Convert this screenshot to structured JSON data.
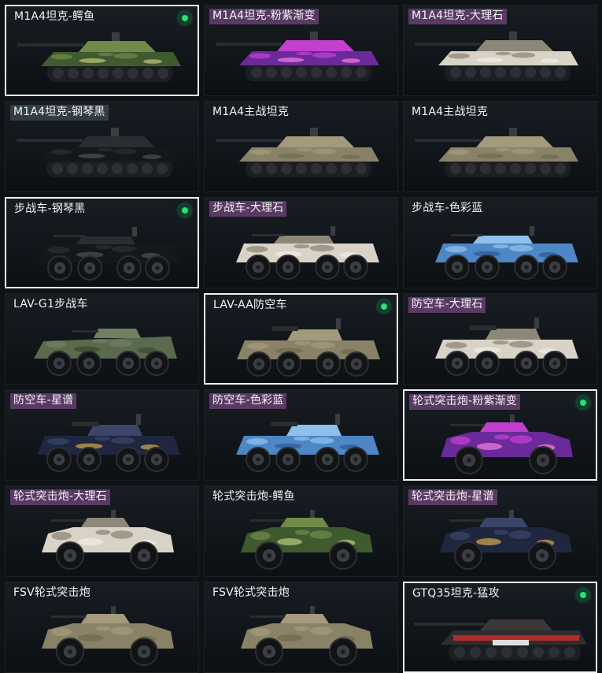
{
  "cards": [
    {
      "name": "M1A4坦克-鳄鱼",
      "type": "tank",
      "camo": "croc",
      "selected": true,
      "owned": true,
      "tag": false
    },
    {
      "name": "M1A4坦克-粉紫渐变",
      "type": "tank",
      "camo": "purple",
      "selected": false,
      "owned": false,
      "tag": true
    },
    {
      "name": "M1A4坦克-大理石",
      "type": "tank",
      "camo": "marble",
      "selected": false,
      "owned": false,
      "tag": true
    },
    {
      "name": "M1A4坦克-钢琴黑",
      "type": "tank",
      "camo": "black",
      "selected": false,
      "owned": false,
      "tag": true
    },
    {
      "name": "M1A4主战坦克",
      "type": "tank",
      "camo": "desert",
      "selected": false,
      "owned": false,
      "tag": false
    },
    {
      "name": "M1A4主战坦克",
      "type": "tank",
      "camo": "desert",
      "selected": false,
      "owned": false,
      "tag": false
    },
    {
      "name": "步战车-钢琴黑",
      "type": "ifv",
      "camo": "black",
      "selected": true,
      "owned": true,
      "tag": false
    },
    {
      "name": "步战车-大理石",
      "type": "ifv",
      "camo": "marble",
      "selected": false,
      "owned": false,
      "tag": true
    },
    {
      "name": "步战车-色彩蓝",
      "type": "ifv",
      "camo": "blue",
      "selected": false,
      "owned": false,
      "tag": false
    },
    {
      "name": "LAV-G1步战车",
      "type": "lav",
      "camo": "green",
      "selected": false,
      "owned": false,
      "tag": false
    },
    {
      "name": "LAV-AA防空车",
      "type": "aa",
      "camo": "desert",
      "selected": true,
      "owned": true,
      "tag": false
    },
    {
      "name": "防空车-大理石",
      "type": "aa",
      "camo": "marble",
      "selected": false,
      "owned": false,
      "tag": true
    },
    {
      "name": "防空车-星谱",
      "type": "aa",
      "camo": "star",
      "selected": false,
      "owned": false,
      "tag": true
    },
    {
      "name": "防空车-色彩蓝",
      "type": "aa",
      "camo": "blue",
      "selected": false,
      "owned": false,
      "tag": true
    },
    {
      "name": "轮式突击炮-粉紫渐变",
      "type": "assault",
      "camo": "purple",
      "selected": true,
      "owned": true,
      "tag": true
    },
    {
      "name": "轮式突击炮-大理石",
      "type": "assault",
      "camo": "marble",
      "selected": false,
      "owned": false,
      "tag": true
    },
    {
      "name": "轮式突击炮-鳄鱼",
      "type": "assault",
      "camo": "croc",
      "selected": false,
      "owned": false,
      "tag": false
    },
    {
      "name": "轮式突击炮-星谱",
      "type": "assault",
      "camo": "star",
      "selected": false,
      "owned": false,
      "tag": true
    },
    {
      "name": "FSV轮式突击炮",
      "type": "assault",
      "camo": "desert",
      "selected": false,
      "owned": false,
      "tag": false
    },
    {
      "name": "FSV轮式突击炮",
      "type": "assault",
      "camo": "desert",
      "selected": false,
      "owned": false,
      "tag": false
    },
    {
      "name": "GTQ35坦克-猛攻",
      "type": "tank35",
      "camo": "red",
      "selected": true,
      "owned": true,
      "tag": false
    }
  ],
  "owned_icon": "green-dot-icon",
  "camo_colors": {
    "croc": "#4f6b3a",
    "purple": "#9a3cc2",
    "marble": "#bfb7a8",
    "black": "#1c1f22",
    "desert": "#8a8266",
    "blue": "#5d8fc8",
    "green": "#5a6a4c",
    "star": "#2c3652",
    "red": "#3a2a2a"
  },
  "accent": "#27e07f"
}
